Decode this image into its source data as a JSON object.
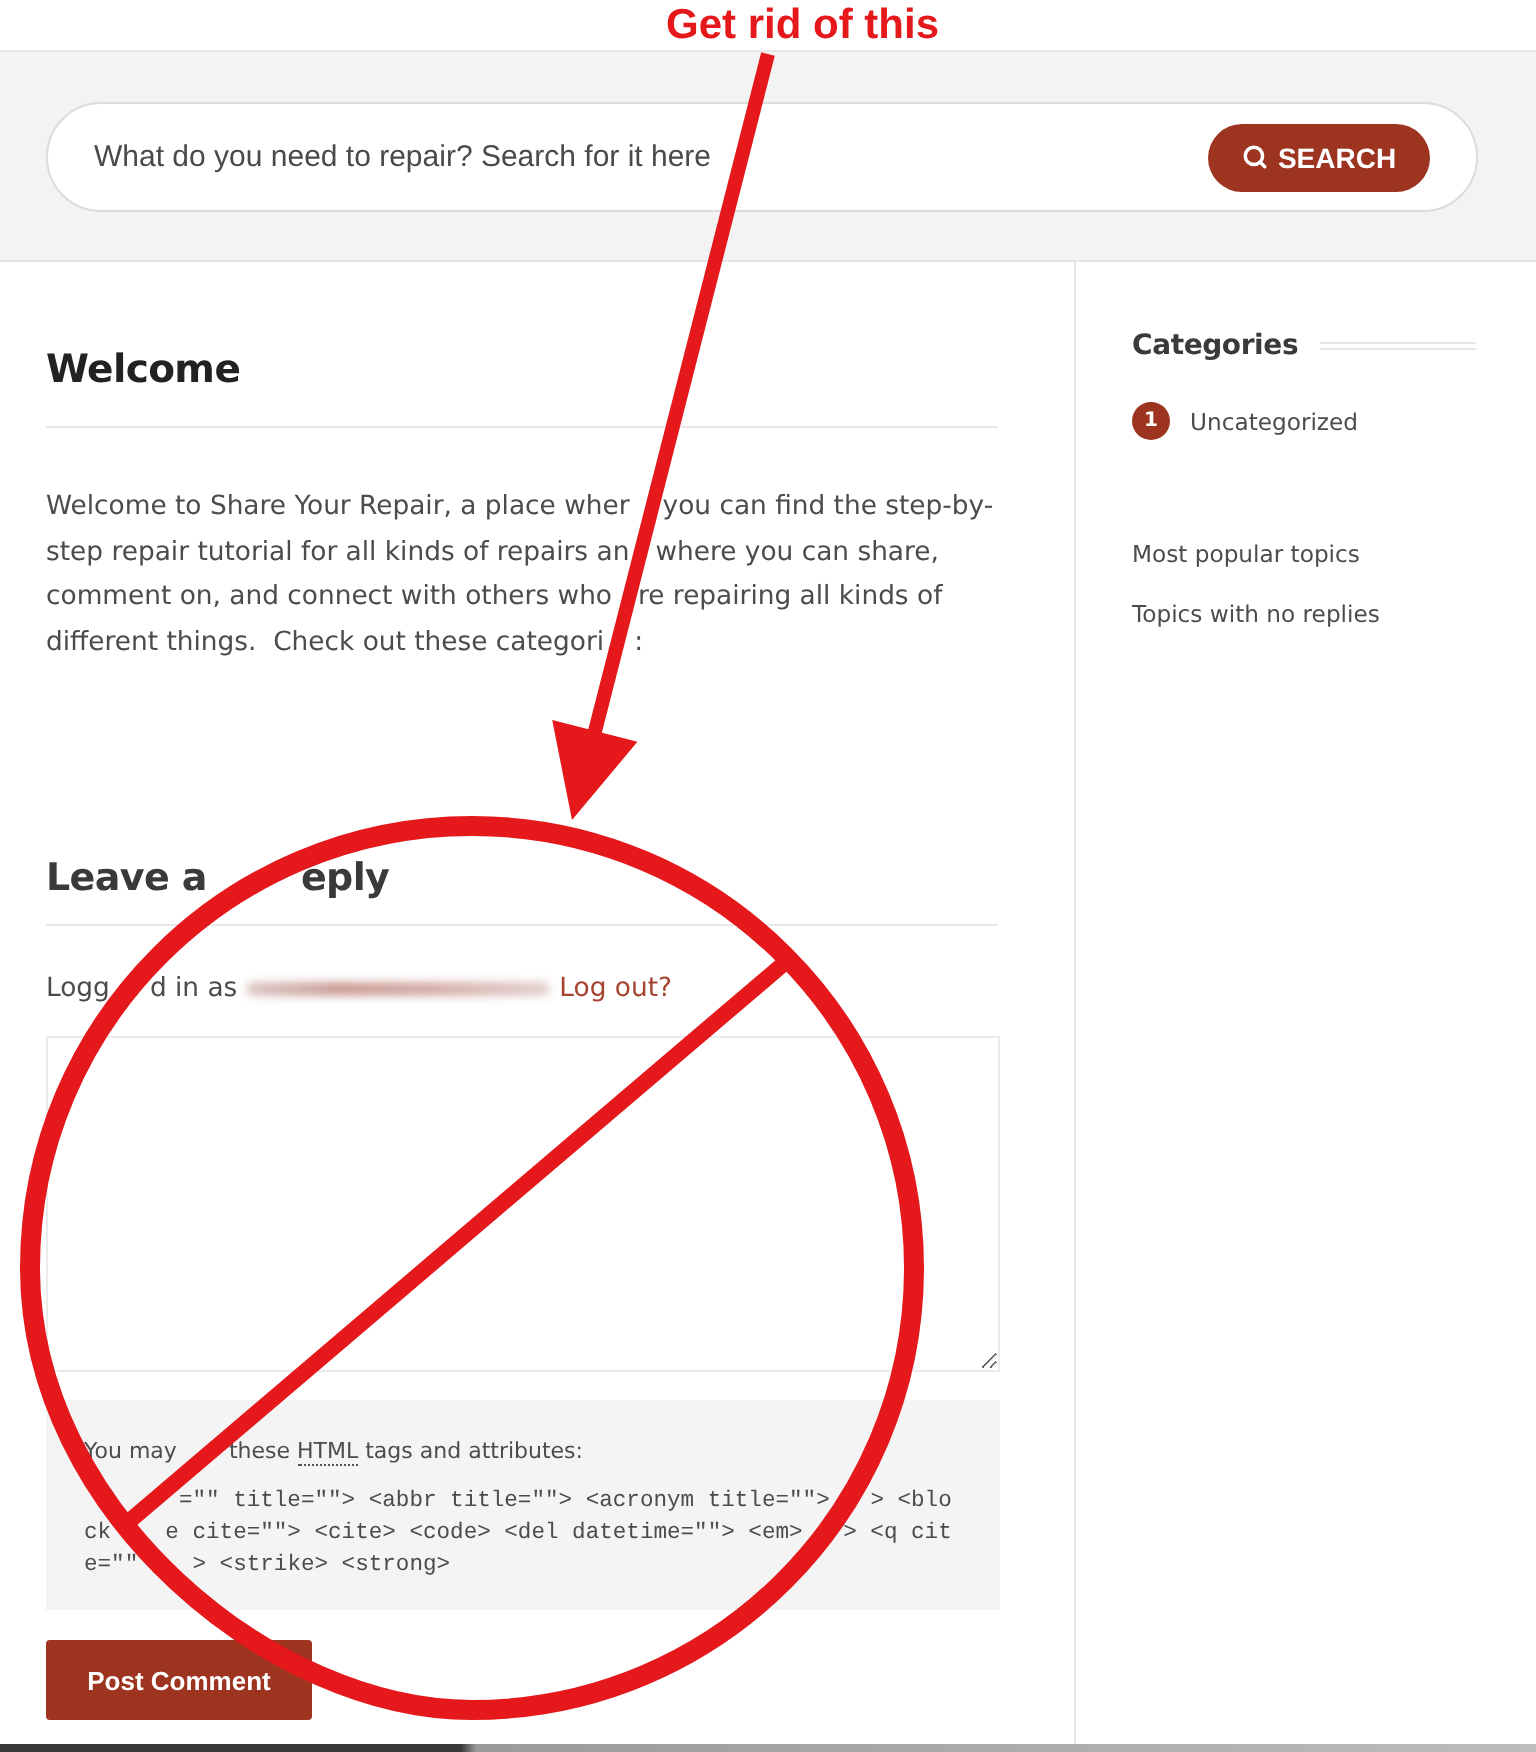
{
  "annotation": {
    "text": "Get rid of this"
  },
  "search": {
    "placeholder": "What do you need to repair? Search for it here",
    "button": "SEARCH"
  },
  "welcome": {
    "title": "Welcome",
    "body": [
      "Welcome to Share Your Repair, a place wher",
      "you can find the step-by-step repair tutorial for all kinds of repairs an",
      "where you can share, comment on, and connect with others who",
      "re repairing all kinds of different things.  Check out these categori",
      ":"
    ]
  },
  "reply": {
    "title": [
      "Leave a",
      "eply"
    ],
    "logged_in": [
      "Logg",
      "d in as"
    ],
    "logout": "Log out?",
    "allowed_tags": {
      "parts": [
        {
          "kind": "plain",
          "text": "You may"
        },
        {
          "kind": "plain",
          "text": "these "
        },
        {
          "kind": "abbr",
          "text": "HTML"
        },
        {
          "kind": "plain",
          "text": " tags and attributes:"
        }
      ],
      "code_lines": [
        [
          "=\"\" title=\"\"> <abbr title=\"\"> <acronym title=\"\">",
          "> <blo"
        ],
        [
          "ck",
          "e cite=\"\"> <cite> <code> <del datetime=\"\"> <em>",
          "> <q cit"
        ],
        [
          "e=\"\"",
          "> <strike> <strong>"
        ]
      ]
    },
    "submit": "Post Comment"
  },
  "sidebar": {
    "title": "Categories",
    "categories": [
      {
        "count": "1",
        "name": "Uncategorized"
      }
    ],
    "links": [
      "Most popular topics",
      "Topics with no replies"
    ]
  }
}
